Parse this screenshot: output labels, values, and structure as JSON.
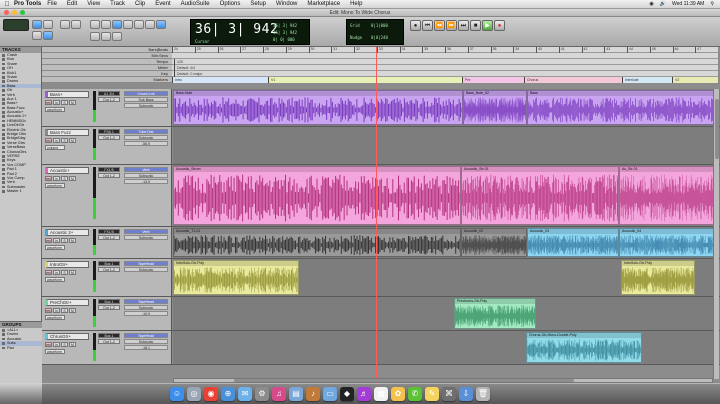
{
  "menubar": {
    "app": "Pro Tools",
    "items": [
      "File",
      "Edit",
      "View",
      "Track",
      "Clip",
      "Event",
      "AudioSuite",
      "Options",
      "Setup",
      "Window",
      "Marketplace",
      "Help"
    ],
    "clock": "Wed 11:39 AM"
  },
  "window": {
    "title": "Edit: Mono To Wide Chorus"
  },
  "toolbar": {
    "counter_main": "36| 3| 942",
    "counter_start": "36| 3| 942",
    "counter_end": "36| 3| 942",
    "counter_length": "0| 0| 000",
    "cursor_label": "Cursor",
    "nudge_label": "Nudge",
    "grid_label": "Grid",
    "grid_value": "0|1|000",
    "nudge_value": "0|0|240"
  },
  "left_panel": {
    "tracks_header": "TRACKS",
    "tracks": [
      "Crash",
      "Kick",
      "Snare",
      "OH",
      "Kick1",
      "Snare",
      "Drums",
      "Bass",
      "Gtr",
      "Verb",
      "Aux 1",
      "Bass+",
      "Bass Fuzz",
      "Acoustic+",
      "Acoustic 2+",
      "HEMMDDx",
      "LiveDirGtr",
      "Electric Gtr",
      "Bridge Gtrs",
      "BridgeDlay",
      "Verse Gtrs",
      "VerseBass",
      "ChorusGtrs",
      "VERSE",
      "Keys",
      "Vox COMP",
      "Pad 1",
      "Pad 2",
      "Vox Comp",
      "Verb",
      "Submaster",
      "Master 1"
    ],
    "groups_header": "GROUPS",
    "groups": [
      "<ALL>",
      "Drums",
      "Acoustic",
      "Subs",
      "Pad"
    ]
  },
  "rulers": {
    "rows": [
      "Bars|Beats",
      "Min:Secs",
      "Tempo",
      "Meter",
      "Key",
      "Markers"
    ],
    "bars": [
      "24",
      "25",
      "26",
      "27",
      "28",
      "29",
      "30",
      "31",
      "32",
      "33",
      "34",
      "35",
      "36",
      "37",
      "38",
      "39",
      "40",
      "41",
      "42",
      "43",
      "44",
      "45",
      "46",
      "47"
    ],
    "tempo": "120",
    "meter": "Default: 4/4",
    "key": "Default: C major",
    "markers": [
      "Intro",
      "V1",
      "Pre",
      "Chorus",
      "Interlude",
      "V2"
    ]
  },
  "tracks": [
    {
      "name": "Bass+",
      "input": "A1 3/4",
      "output": "Out 1-2",
      "mode": "waveform",
      "color": "#9b5fd6",
      "clips": [
        {
          "name": "Bass-Note",
          "fill": "#c9a4f0",
          "wave": "#7a3bbf"
        },
        {
          "name": "Bass_Note_02",
          "fill": "#c9a4f0",
          "wave": "#7a3bbf"
        },
        {
          "name": "Bass",
          "fill": "#c9a4f0",
          "wave": "#7a3bbf"
        }
      ],
      "sends": [
        "Crowd Lmt",
        "Sub Bass",
        "Subsonic"
      ]
    },
    {
      "name": "Bass Fuzz",
      "input": "PSA 1",
      "output": "Out 1-2",
      "mode": "volume",
      "color": "#8b8b8b",
      "clips": [],
      "sends": [
        "Tube Dist",
        "Subsonic",
        "-56.9"
      ]
    },
    {
      "name": "Acoustic+",
      "input": "FX1/5",
      "output": "Out 1-2",
      "mode": "waveform",
      "color": "#e06aba",
      "clips": [
        {
          "name": "Acoustic_Strum",
          "fill": "#f4a6dc",
          "wave": "#b4317f"
        },
        {
          "name": "Acoustic_Str-01",
          "fill": "#f4a6dc",
          "wave": "#b4317f"
        },
        {
          "name": "Ac_Str-01",
          "fill": "#f4a6dc",
          "wave": "#b4317f"
        }
      ],
      "sends": [
        "Verb",
        "Subsonic",
        "-13.9"
      ]
    },
    {
      "name": "Acoustic 2+",
      "input": "FX1/5",
      "output": "Out 1-2",
      "mode": "waveform",
      "color": "#4aa6d6",
      "clips": [
        {
          "name": "Acoustic_T1-01",
          "fill": "#9a9a9a",
          "wave": "#333333"
        },
        {
          "name": "Acoustic_02",
          "fill": "#9a9a9a",
          "wave": "#333333"
        },
        {
          "name": "Acoustic_03",
          "fill": "#8fd6f2",
          "wave": "#2a6f9a"
        },
        {
          "name": "Acoustic_04",
          "fill": "#8fd6f2",
          "wave": "#2a6f9a"
        }
      ],
      "sends": [
        "Verb",
        "Subsonic"
      ]
    },
    {
      "name": "IntroGtr+",
      "input": "Bus 1",
      "output": "Out 1-2",
      "mode": "waveform",
      "color": "#d8d46b",
      "clips": [
        {
          "name": "IntroSolo-Gtr-Poly",
          "fill": "#e9ea9e",
          "wave": "#8c8b2a"
        },
        {
          "name": "IntroSolo-Gtr-Poly",
          "fill": "#e9ea9e",
          "wave": "#8c8b2a"
        }
      ],
      "sends": [
        "TapeHead",
        "Subsonic"
      ]
    },
    {
      "name": "PreChGtr+",
      "input": "Bus 1",
      "output": "Out 1-2",
      "mode": "waveform",
      "color": "#6fd6a0",
      "clips": [
        {
          "name": "Prechorus-Gtr-Poly",
          "fill": "#a3e9c3",
          "wave": "#2a8a58"
        }
      ],
      "sends": [
        "TapeHead",
        "Subsonic",
        "-10.9"
      ]
    },
    {
      "name": "ChrusGtr+",
      "input": "Bus 1",
      "output": "Out 1-2",
      "mode": "waveform",
      "color": "#5bc5d8",
      "clips": [
        {
          "name": "Chorus-Gtr-Mono-Double-Poly",
          "fill": "#92dcea",
          "wave": "#2b7c8f"
        }
      ],
      "sends": [
        "TapeHead",
        "Subsonic",
        "-18.1"
      ]
    }
  ]
}
